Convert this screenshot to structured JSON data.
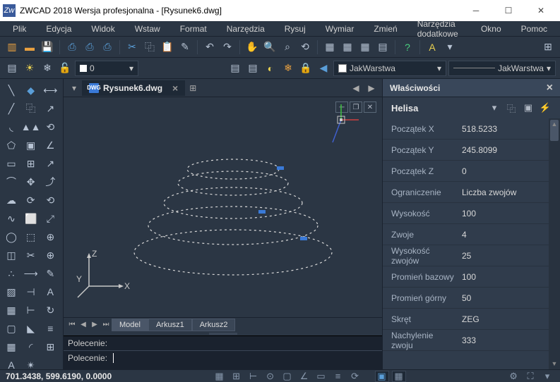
{
  "title": "ZWCAD 2018 Wersja profesjonalna - [Rysunek6.dwg]",
  "menu": [
    "Plik",
    "Edycja",
    "Widok",
    "Wstaw",
    "Format",
    "Narzędzia",
    "Rysuj",
    "Wymiar",
    "Zmień",
    "Narzędzia dodatkowe",
    "Okno",
    "Pomoc"
  ],
  "layer": {
    "name": "0",
    "lineweight": "JakWarstwa",
    "linetype": "JakWarstwa"
  },
  "doctab": {
    "name": "Rysunek6.dwg"
  },
  "modeltabs": [
    "Model",
    "Arkusz1",
    "Arkusz2"
  ],
  "cmd": {
    "prompt": "Polecenie:"
  },
  "axes": {
    "x": "X",
    "y": "Y",
    "z": "Z"
  },
  "properties": {
    "title": "Właściwości",
    "object": "Helisa",
    "rows": [
      {
        "k": "Początek X",
        "v": "518.5233"
      },
      {
        "k": "Początek Y",
        "v": "245.8099"
      },
      {
        "k": "Początek Z",
        "v": "0"
      },
      {
        "k": "Ograniczenie",
        "v": "Liczba zwojów"
      },
      {
        "k": "Wysokość",
        "v": "100"
      },
      {
        "k": "Zwoje",
        "v": "4"
      },
      {
        "k": "Wysokość zwojów",
        "v": "25"
      },
      {
        "k": "Promień bazowy",
        "v": "100"
      },
      {
        "k": "Promień górny",
        "v": "50"
      },
      {
        "k": "Skręt",
        "v": "ZEG"
      },
      {
        "k": "Nachylenie zwoju",
        "v": "333"
      }
    ]
  },
  "status": {
    "coords": "701.3438, 599.6190, 0.0000"
  }
}
